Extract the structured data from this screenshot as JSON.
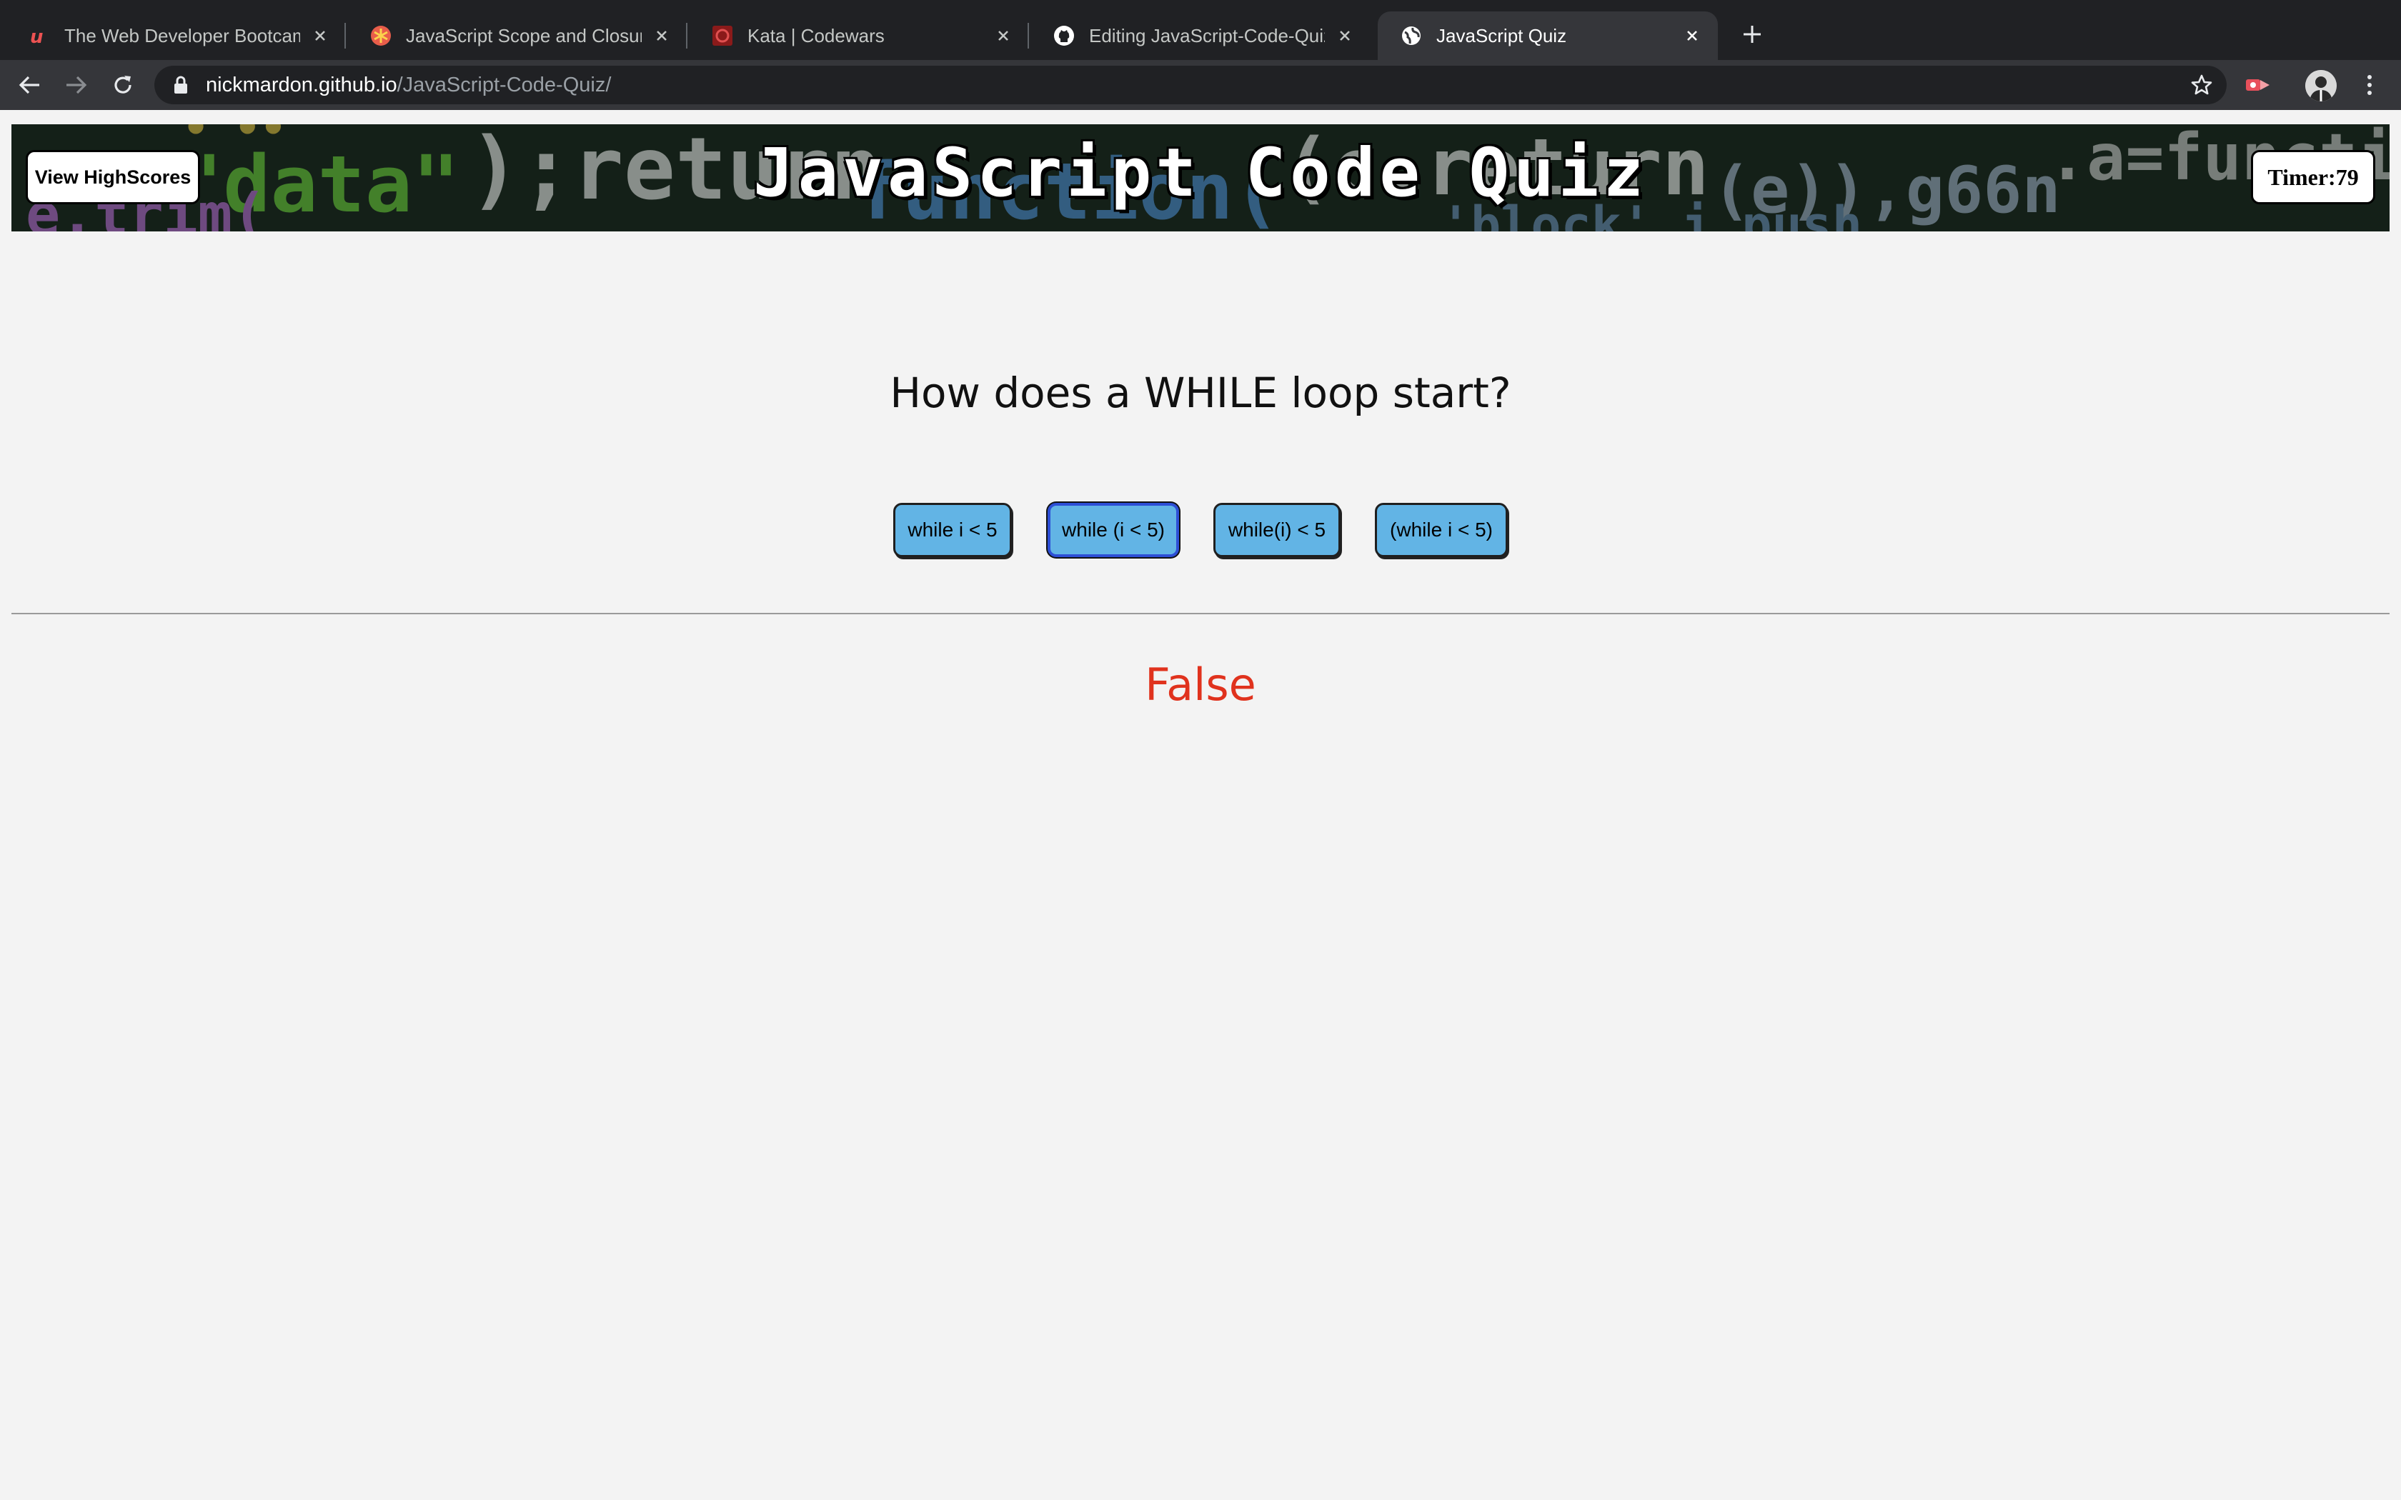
{
  "browser": {
    "tabs": [
      {
        "title": "The Web Developer Bootcamp",
        "favicon": "udemy-icon",
        "active": false
      },
      {
        "title": "JavaScript Scope and Closures",
        "favicon": "css-tricks-icon",
        "active": false
      },
      {
        "title": "Kata | Codewars",
        "favicon": "codewars-icon",
        "active": false
      },
      {
        "title": "Editing JavaScript-Code-Quiz/",
        "favicon": "github-icon",
        "active": false
      },
      {
        "title": "JavaScript Quiz",
        "favicon": "globe-icon",
        "active": true
      }
    ],
    "url_host": "nickmardon.github.io",
    "url_path": "/JavaScript-Code-Quiz/"
  },
  "header": {
    "title": "JavaScript Code Quiz",
    "highscores_label": "View HighScores",
    "timer_label": "Timer:79"
  },
  "quiz": {
    "question": "How does a WHILE loop start?",
    "answers": [
      "while i < 5",
      "while (i < 5)",
      "while(i) < 5",
      "(while i < 5)"
    ],
    "focused_answer": 1,
    "result": "False"
  },
  "colors": {
    "answer_bg": "#62b4e5",
    "result_wrong": "#e0321d",
    "page_bg": "#f3f3f3"
  }
}
